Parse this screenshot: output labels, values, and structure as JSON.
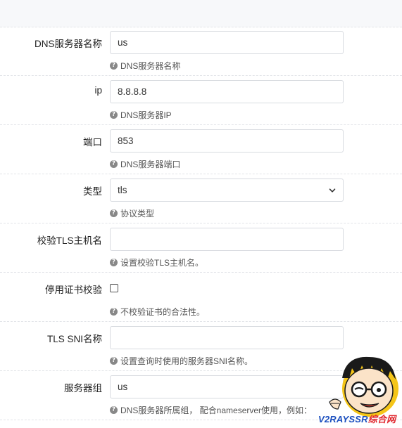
{
  "form": {
    "rows": [
      {
        "label": "DNS服务器名称",
        "value": "us",
        "help": "DNS服务器名称"
      },
      {
        "label": "ip",
        "value": "8.8.8.8",
        "help": "DNS服务器IP"
      },
      {
        "label": "端口",
        "value": "853",
        "help": "DNS服务器端口"
      },
      {
        "label": "类型",
        "value": "tls",
        "help": "协议类型"
      },
      {
        "label": "校验TLS主机名",
        "value": "",
        "help": "设置校验TLS主机名。"
      },
      {
        "label": "停用证书校验",
        "checked": false,
        "help": "不校验证书的合法性。"
      },
      {
        "label": "TLS SNI名称",
        "value": "",
        "help": "设置查询时使用的服务器SNI名称。"
      },
      {
        "label": "服务器组",
        "value": "us",
        "help": "DNS服务器所属组， 配合nameserver使用，例如："
      }
    ]
  },
  "watermark": {
    "text_part1": "V2RAYSSR",
    "text_part2": "综合网"
  },
  "colors": {
    "border": "#d8dbe0",
    "help_icon": "#888888",
    "watermark_blue": "#1b4fbf",
    "watermark_red": "#e0262d"
  }
}
